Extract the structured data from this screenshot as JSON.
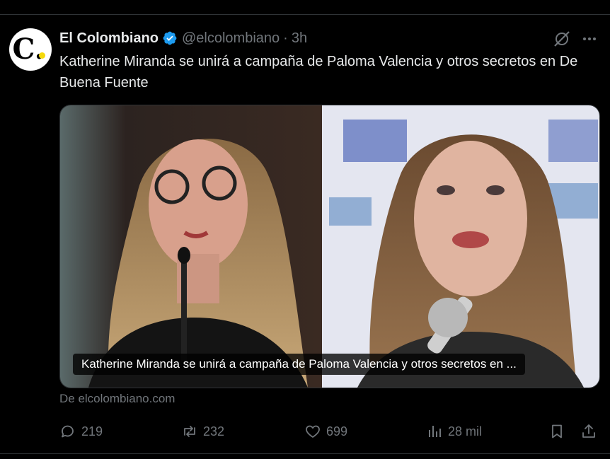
{
  "tweet": {
    "display_name": "El Colombiano",
    "handle": "@elcolombiano",
    "separator": "·",
    "time": "3h",
    "text": "Katherine Miranda se unirá a campaña de Paloma Valencia y otros secretos en De Buena Fuente",
    "avatar_letter": "C.",
    "media_caption": "Katherine Miranda se unirá a campaña de Paloma Valencia y otros secretos en ...",
    "source": "De elcolombiano.com",
    "verified_icon": "verified-badge-icon",
    "colors": {
      "background": "#000000",
      "text": "#e7e9ea",
      "muted": "#71767b",
      "verified": "#1d9bf0",
      "logo_dot": "#f5d90a"
    }
  },
  "actions": {
    "replies": "219",
    "reposts": "232",
    "likes": "699",
    "views": "28 mil"
  }
}
